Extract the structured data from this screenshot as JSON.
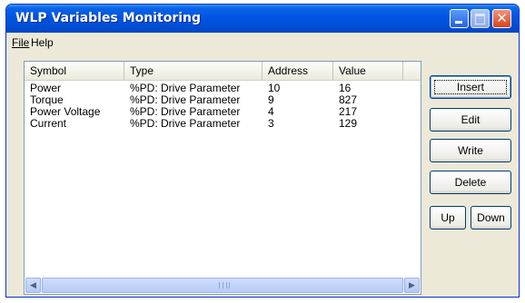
{
  "window": {
    "title": "WLP Variables Monitoring"
  },
  "menu": {
    "file": "File",
    "help": "Help"
  },
  "table": {
    "columns": [
      "Symbol",
      "Type",
      "Address",
      "Value"
    ],
    "rows": [
      {
        "symbol": "Power",
        "type": "%PD: Drive Parameter",
        "address": "10",
        "value": "16"
      },
      {
        "symbol": "Torque",
        "type": "%PD: Drive Parameter",
        "address": "9",
        "value": "827"
      },
      {
        "symbol": "Power Voltage",
        "type": "%PD: Drive Parameter",
        "address": "4",
        "value": "217"
      },
      {
        "symbol": "Current",
        "type": "%PD: Drive Parameter",
        "address": "3",
        "value": "129"
      }
    ]
  },
  "buttons": {
    "insert": "Insert",
    "edit": "Edit",
    "write": "Write",
    "delete": "Delete",
    "up": "Up",
    "down": "Down"
  },
  "icons": {
    "minimize": "minimize-icon",
    "maximize": "maximize-icon",
    "close": "close-icon",
    "scroll_left": "arrow-left-icon",
    "scroll_right": "arrow-right-icon"
  },
  "colors": {
    "titlebar": "#0054e3",
    "close_button": "#e04a20",
    "window_bg": "#ece9d8"
  }
}
